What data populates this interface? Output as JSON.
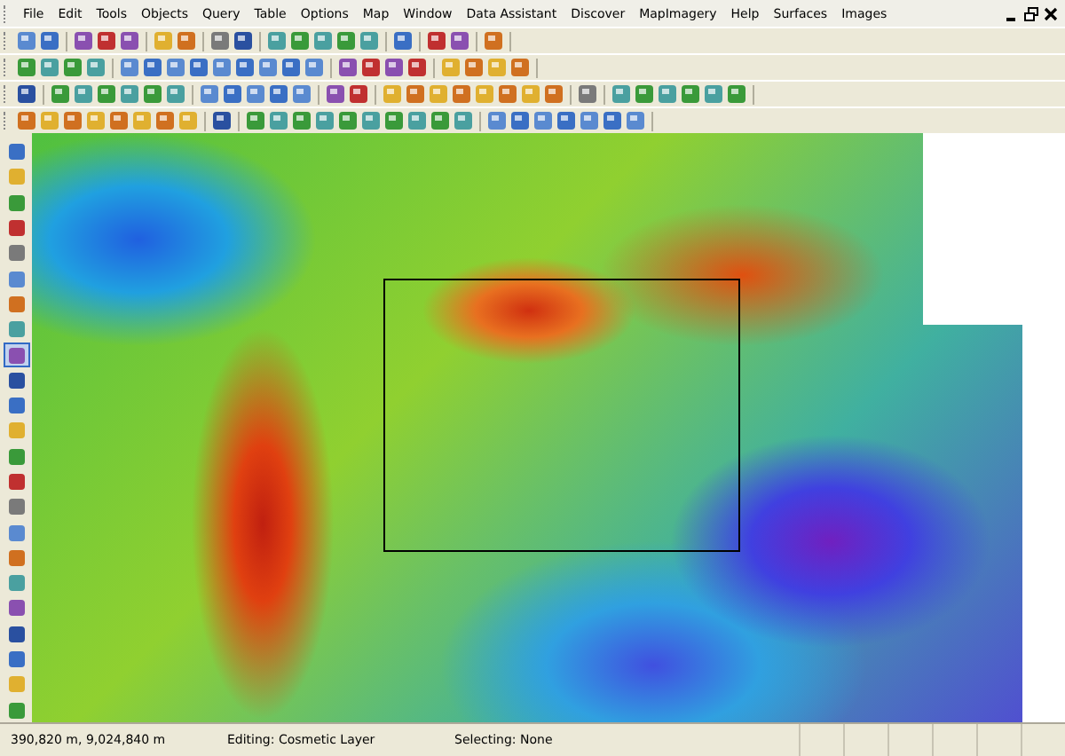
{
  "menu_bar": {
    "items": [
      "File",
      "Edit",
      "Tools",
      "Objects",
      "Query",
      "Table",
      "Options",
      "Map",
      "Window",
      "Data Assistant",
      "Discover",
      "MapImagery",
      "Help",
      "Surfaces",
      "Images"
    ]
  },
  "left_toolbar": {
    "tools": [
      {
        "selected": false
      },
      {
        "selected": false
      },
      {
        "selected": false
      },
      {
        "selected": false
      },
      {
        "selected": false
      },
      {
        "selected": false
      },
      {
        "selected": false
      },
      {
        "selected": false
      },
      {
        "selected": true
      },
      {
        "selected": false
      },
      {
        "selected": false
      },
      {
        "selected": false
      },
      {
        "selected": false
      },
      {
        "selected": false
      },
      {
        "selected": false
      },
      {
        "selected": false
      },
      {
        "selected": false
      },
      {
        "selected": false
      },
      {
        "selected": false
      },
      {
        "selected": false
      },
      {
        "selected": false
      },
      {
        "selected": false
      },
      {
        "selected": false
      }
    ]
  },
  "status_bar": {
    "coordinates": "390,820 m, 9,024,840 m",
    "editing": "Editing: Cosmetic Layer",
    "selecting": "Selecting: None"
  }
}
